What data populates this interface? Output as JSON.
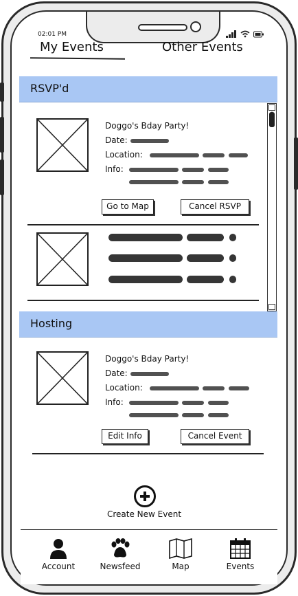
{
  "status": {
    "time": "02:01 PM"
  },
  "tabs": [
    {
      "label": "My Events",
      "active": true
    },
    {
      "label": "Other Events",
      "active": false
    }
  ],
  "rsvp": {
    "header": "RSVP'd",
    "event": {
      "title": "Doggo's Bday Party!",
      "date_label": "Date:",
      "location_label": "Location:",
      "info_label": "Info:",
      "buttons": {
        "map": "Go to Map",
        "cancel": "Cancel RSVP"
      }
    }
  },
  "hosting": {
    "header": "Hosting",
    "event": {
      "title": "Doggo's Bday Party!",
      "date_label": "Date:",
      "location_label": "Location:",
      "info_label": "Info:",
      "buttons": {
        "edit": "Edit Info",
        "cancel": "Cancel Event"
      }
    }
  },
  "create": {
    "label": "Create New Event",
    "icon": "plus-circle-icon"
  },
  "nav": [
    {
      "label": "Account",
      "icon": "person-icon"
    },
    {
      "label": "Newsfeed",
      "icon": "paw-icon"
    },
    {
      "label": "Map",
      "icon": "map-icon"
    },
    {
      "label": "Events",
      "icon": "calendar-icon"
    }
  ],
  "colors": {
    "section_header": "#a9c7f4",
    "ink": "#222222"
  }
}
